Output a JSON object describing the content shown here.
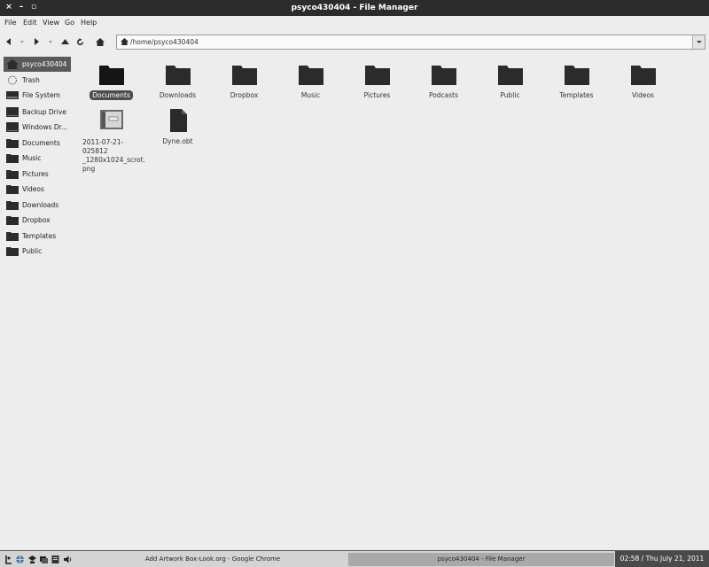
{
  "window": {
    "title": "psyco430404 - File Manager",
    "close": "×",
    "minimize": "–",
    "maximize": "▫"
  },
  "menu": [
    "File",
    "Edit",
    "View",
    "Go",
    "Help"
  ],
  "address": {
    "path": "/home/psyco430404"
  },
  "sidebar": [
    {
      "label": "psyco430404",
      "icon": "home-icon",
      "active": true
    },
    {
      "label": "Trash",
      "icon": "trash-icon"
    },
    {
      "label": "File System",
      "icon": "drive-icon"
    },
    {
      "label": "Backup Drive",
      "icon": "drive-icon"
    },
    {
      "label": "Windows Dr...",
      "icon": "drive-icon"
    },
    {
      "label": "Documents",
      "icon": "folder-icon"
    },
    {
      "label": "Music",
      "icon": "folder-icon"
    },
    {
      "label": "Pictures",
      "icon": "folder-icon"
    },
    {
      "label": "Videos",
      "icon": "folder-icon"
    },
    {
      "label": "Downloads",
      "icon": "folder-icon"
    },
    {
      "label": "Dropbox",
      "icon": "folder-icon"
    },
    {
      "label": "Templates",
      "icon": "folder-icon"
    },
    {
      "label": "Public",
      "icon": "folder-icon"
    }
  ],
  "files": [
    {
      "name": "Documents",
      "type": "folder",
      "selected": true
    },
    {
      "name": "Downloads",
      "type": "folder"
    },
    {
      "name": "Dropbox",
      "type": "folder"
    },
    {
      "name": "Music",
      "type": "folder"
    },
    {
      "name": "Pictures",
      "type": "folder"
    },
    {
      "name": "Podcasts",
      "type": "folder"
    },
    {
      "name": "Public",
      "type": "folder"
    },
    {
      "name": "Templates",
      "type": "folder"
    },
    {
      "name": "Videos",
      "type": "folder"
    },
    {
      "name": "2011-07-21-025812_1280x1024_scrot.png",
      "display_lines": [
        "2011-07-21-025812",
        "_1280x1024_scrot.",
        "png"
      ],
      "type": "image"
    },
    {
      "name": "Dyne.obt",
      "type": "file"
    }
  ],
  "taskbar": {
    "tasks": [
      {
        "label": "Add Artwork Box-Look.org - Google Chrome"
      },
      {
        "label": "psyco430404 - File Manager",
        "active": true
      }
    ],
    "clock": "02:58 / Thu July 21, 2011"
  },
  "colors": {
    "titlebar": "#2c2c2c",
    "background": "#ededed",
    "selection": "#4d4d4d",
    "folder": "#2b2b2b"
  }
}
